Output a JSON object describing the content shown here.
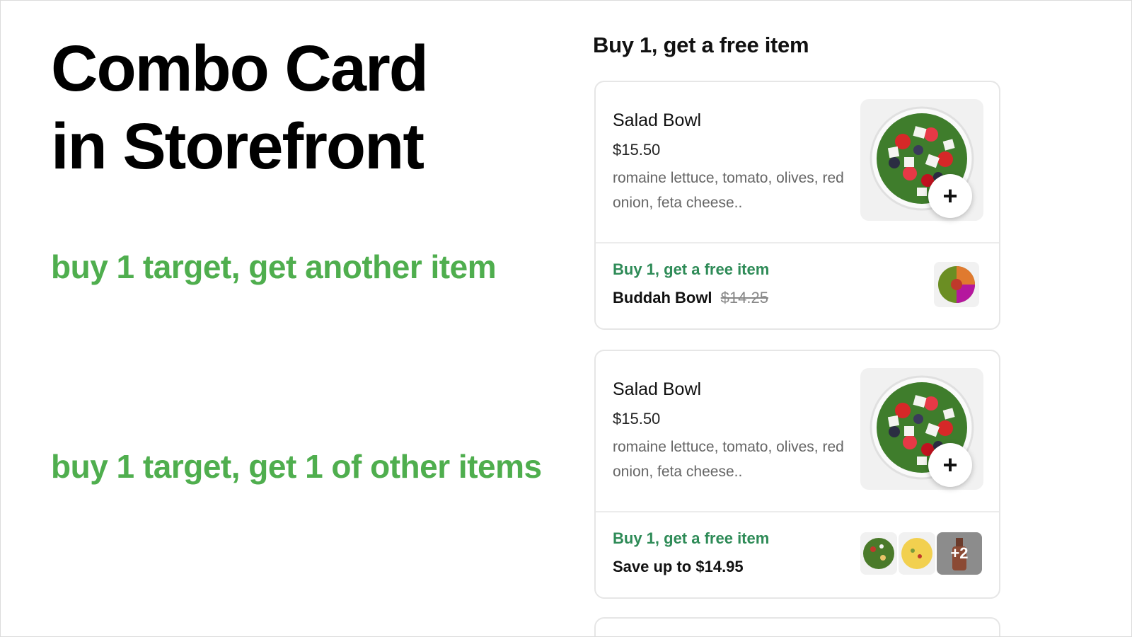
{
  "title": {
    "line1": "Combo Card",
    "line2": "in Storefront"
  },
  "notes": {
    "note1": "buy 1 target, get another item",
    "note2": "buy 1 target, get 1 of other items"
  },
  "section_heading": "Buy 1, get a free item",
  "cards": [
    {
      "item_name": "Salad Bowl",
      "price": "$15.50",
      "description": "romaine lettuce, tomato, olives, red onion, feta cheese..",
      "add_label": "+",
      "promo_label": "Buy 1, get a free item",
      "promo_item": "Buddah Bowl",
      "promo_original_price": "$14.25"
    },
    {
      "item_name": "Salad Bowl",
      "price": "$15.50",
      "description": "romaine lettuce, tomato, olives, red onion, feta cheese..",
      "add_label": "+",
      "promo_label": "Buy 1, get a free item",
      "promo_savings": "Save up to $14.95",
      "more_count": "+2"
    }
  ],
  "colors": {
    "accent_green": "#4fae4e",
    "promo_green": "#2e8b57"
  }
}
